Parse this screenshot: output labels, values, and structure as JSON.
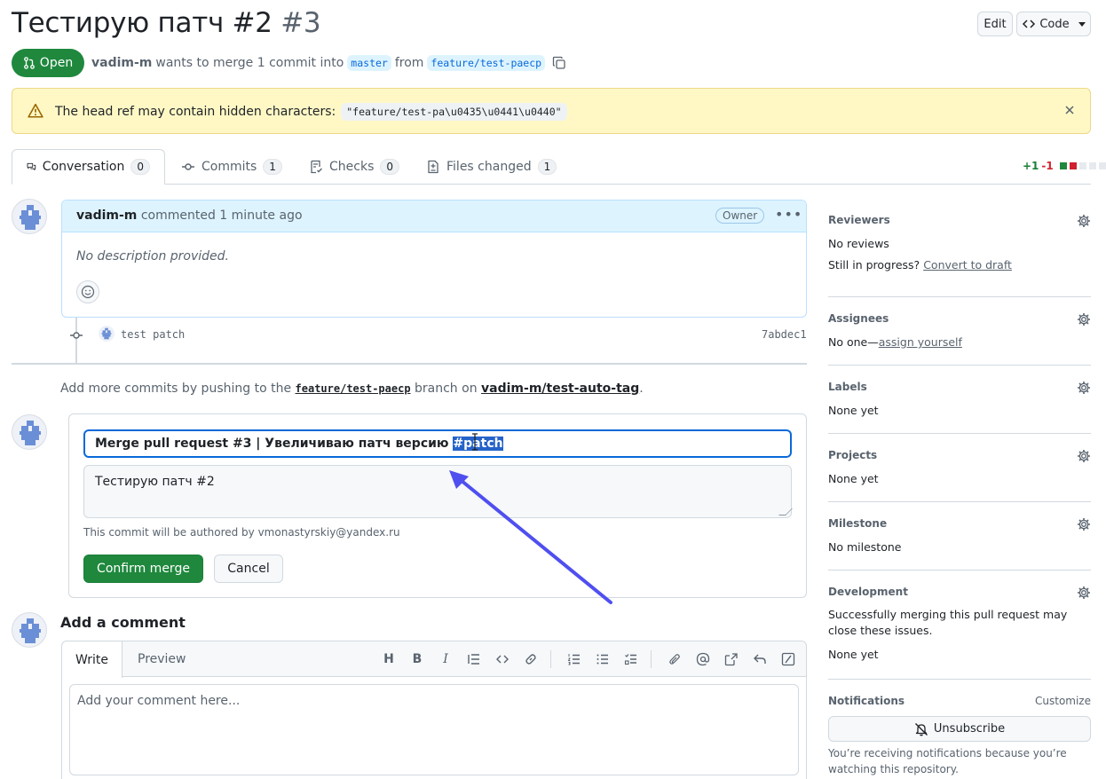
{
  "header": {
    "title": "Тестирую патч #2",
    "number": "#3",
    "edit_label": "Edit",
    "code_label": "Code"
  },
  "pr_state": {
    "label": "Open",
    "author": "vadim-m",
    "wants_text": "wants to merge 1 commit into",
    "base_branch": "master",
    "from_text": "from",
    "head_branch": "feature/test-paecp"
  },
  "banner": {
    "text": "The head ref may contain hidden characters:",
    "code": "\"feature/test-pa\\u0435\\u0441\\u0440\""
  },
  "tabs": [
    {
      "label": "Conversation",
      "count": "0"
    },
    {
      "label": "Commits",
      "count": "1"
    },
    {
      "label": "Checks",
      "count": "0"
    },
    {
      "label": "Files changed",
      "count": "1"
    }
  ],
  "diffstat": {
    "additions": "+1",
    "deletions": "-1"
  },
  "comment": {
    "author": "vadim-m",
    "action": "commented 1 minute ago",
    "role": "Owner",
    "body": "No description provided."
  },
  "commit": {
    "message": "test patch",
    "sha": "7abdec1"
  },
  "push_hint": {
    "prefix": "Add more commits by pushing to the",
    "branch": "feature/test-paecp",
    "middle": "branch on",
    "repo": "vadim-m/test-auto-tag"
  },
  "merge": {
    "title_prefix": "Merge pull request #3 | Увеличиваю патч версию",
    "title_selected": "#patch",
    "body": "Тестирую патч #2",
    "authored_note": "This commit will be authored by vmonastyrskiy@yandex.ru",
    "confirm_label": "Confirm merge",
    "cancel_label": "Cancel"
  },
  "add_comment": {
    "title": "Add a comment",
    "write_tab": "Write",
    "preview_tab": "Preview",
    "placeholder": "Add your comment here..."
  },
  "sidebar": {
    "reviewers": {
      "heading": "Reviewers",
      "value": "No reviews",
      "progress_text": "Still in progress?",
      "progress_link": "Convert to draft"
    },
    "assignees": {
      "heading": "Assignees",
      "value_prefix": "No one—",
      "value_link": "assign yourself"
    },
    "labels": {
      "heading": "Labels",
      "value": "None yet"
    },
    "projects": {
      "heading": "Projects",
      "value": "None yet"
    },
    "milestone": {
      "heading": "Milestone",
      "value": "No milestone"
    },
    "development": {
      "heading": "Development",
      "description": "Successfully merging this pull request may close these issues.",
      "value": "None yet"
    },
    "notifications": {
      "heading": "Notifications",
      "customize": "Customize",
      "button": "Unsubscribe",
      "note": "You’re receiving notifications because you’re watching this repository."
    }
  },
  "colors": {
    "open_green": "#1f883d",
    "link_blue": "#0969da",
    "banner_yellow": "#fff8c5",
    "selection_blue": "#2563c9",
    "arrow": "#4f4ff0"
  }
}
